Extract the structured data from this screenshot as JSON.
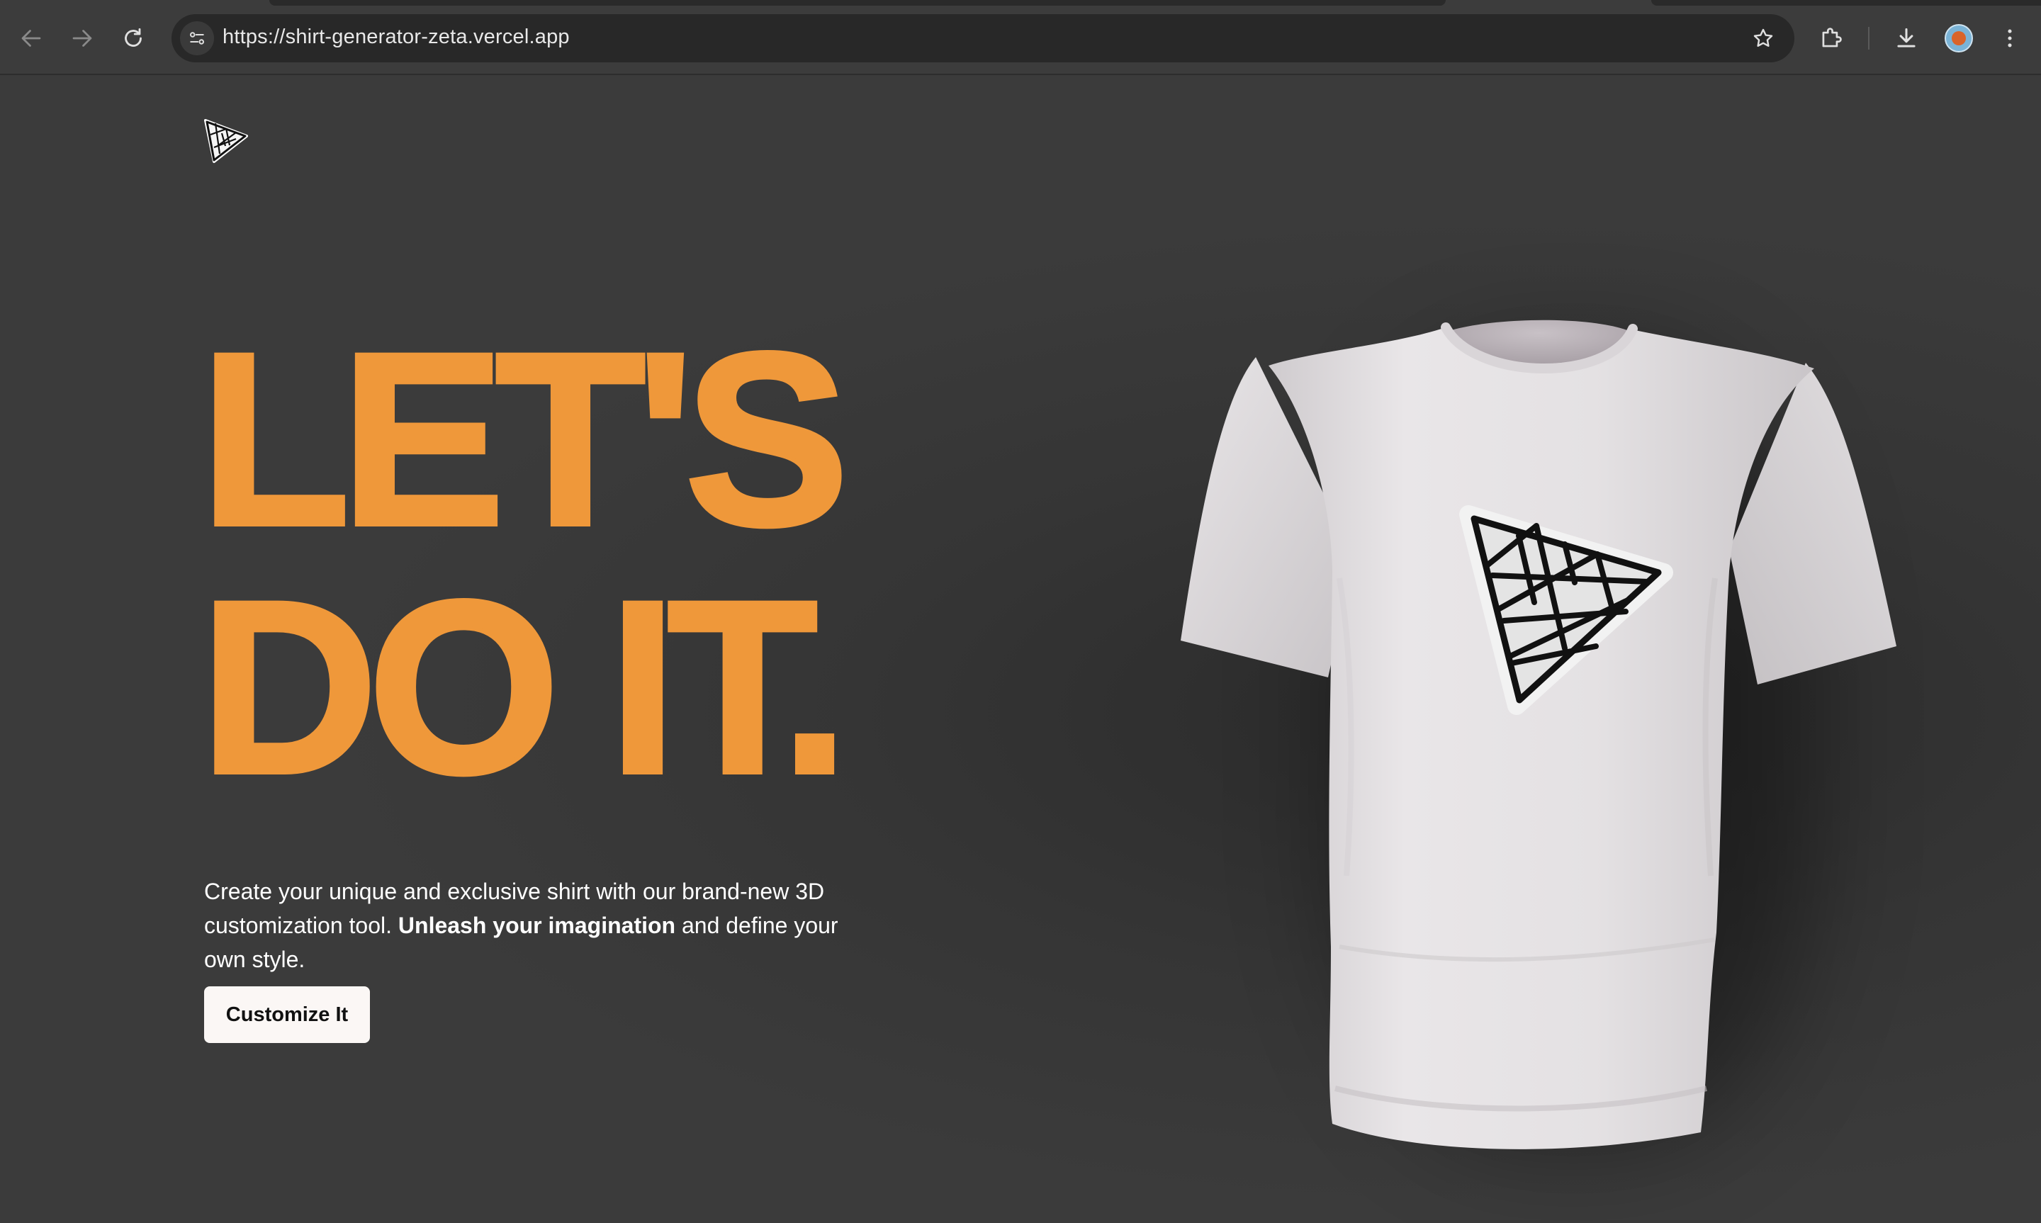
{
  "browser": {
    "url": "https://shirt-generator-zeta.vercel.app",
    "icons": [
      "back-icon",
      "forward-icon",
      "reload-icon",
      "site-info-icon",
      "bookmark-star-icon",
      "extensions-icon",
      "download-icon",
      "profile-avatar",
      "more-menu-icon"
    ]
  },
  "page": {
    "headline_line1": "LET'S",
    "headline_line2": "DO IT.",
    "description_part1": "Create your unique and exclusive shirt with our brand-new 3D customization tool. ",
    "description_bold": "Unleash your imagination",
    "description_part2": " and define your own style.",
    "cta_label": "Customize It",
    "accent_color": "#ef983a",
    "background_color": "#3b3b3b",
    "shirt_color": "#e6e3e5"
  }
}
